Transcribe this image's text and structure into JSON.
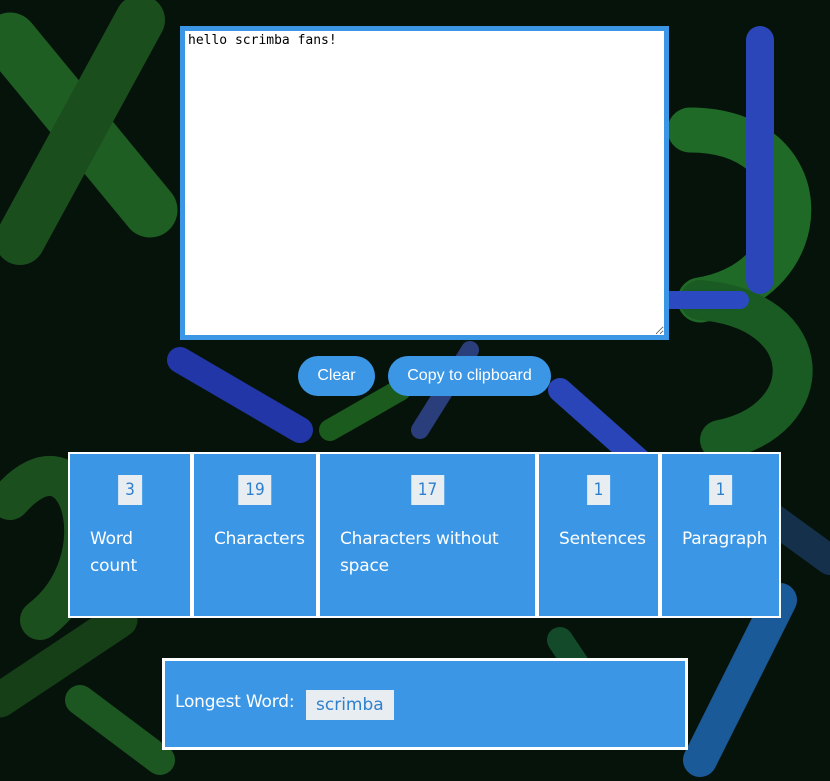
{
  "editor": {
    "value": "hello scrimba fans!",
    "colors": {
      "border": "#3b96e6",
      "background": "#ffffff"
    }
  },
  "buttons": {
    "clear_label": "Clear",
    "copy_label": "Copy to clipboard"
  },
  "stats": [
    {
      "value": "3",
      "label": "Word count"
    },
    {
      "value": "19",
      "label": "Characters"
    },
    {
      "value": "17",
      "label": "Characters without space"
    },
    {
      "value": "1",
      "label": "Sentences"
    },
    {
      "value": "1",
      "label": "Paragraph"
    }
  ],
  "longest": {
    "label": "Longest Word:",
    "value": "scrimba"
  },
  "colors": {
    "accent": "#3b96e6",
    "badge_bg": "#e8edf2",
    "badge_text": "#2e7fcc",
    "background_dark": "#05140a",
    "background_green": "#1d5a1d",
    "background_blue": "#1f3fa6"
  }
}
